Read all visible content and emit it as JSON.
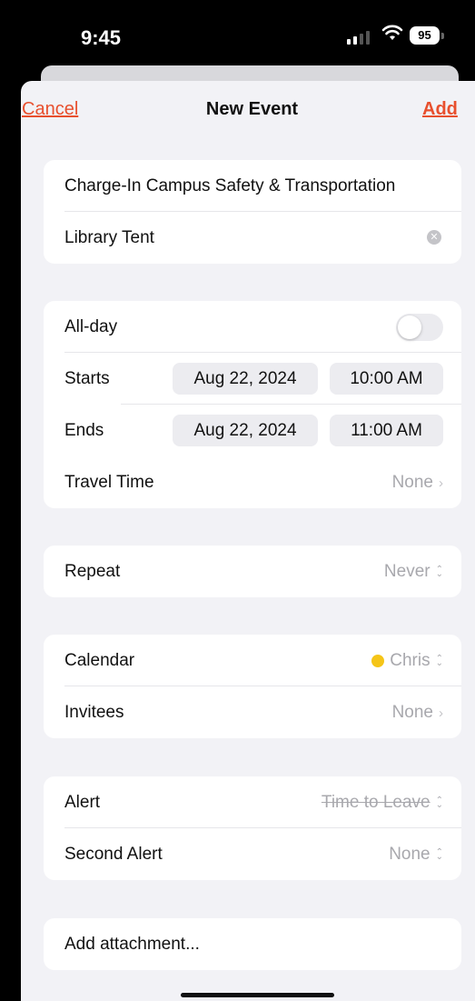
{
  "status_bar": {
    "time": "9:45",
    "battery": "95"
  },
  "nav": {
    "cancel": "Cancel",
    "title": "New Event",
    "add": "Add"
  },
  "event": {
    "title": "Charge-In Campus Safety & Transportation",
    "location": "Library Tent"
  },
  "timing": {
    "all_day_label": "All-day",
    "all_day_on": false,
    "starts_label": "Starts",
    "start_date": "Aug 22, 2024",
    "start_time": "10:00 AM",
    "ends_label": "Ends",
    "end_date": "Aug 22, 2024",
    "end_time": "11:00 AM",
    "travel_label": "Travel Time",
    "travel_value": "None"
  },
  "repeat": {
    "label": "Repeat",
    "value": "Never"
  },
  "calendar": {
    "calendar_label": "Calendar",
    "calendar_value": "Chris",
    "calendar_color": "#f5c518",
    "invitees_label": "Invitees",
    "invitees_value": "None"
  },
  "alerts": {
    "alert_label": "Alert",
    "alert_value": "Time to Leave",
    "second_label": "Second Alert",
    "second_value": "None"
  },
  "attachment": {
    "label": "Add attachment..."
  },
  "colors": {
    "accent": "#e8502e",
    "background": "#f2f2f6",
    "secondary_text": "#a8a8ad"
  }
}
